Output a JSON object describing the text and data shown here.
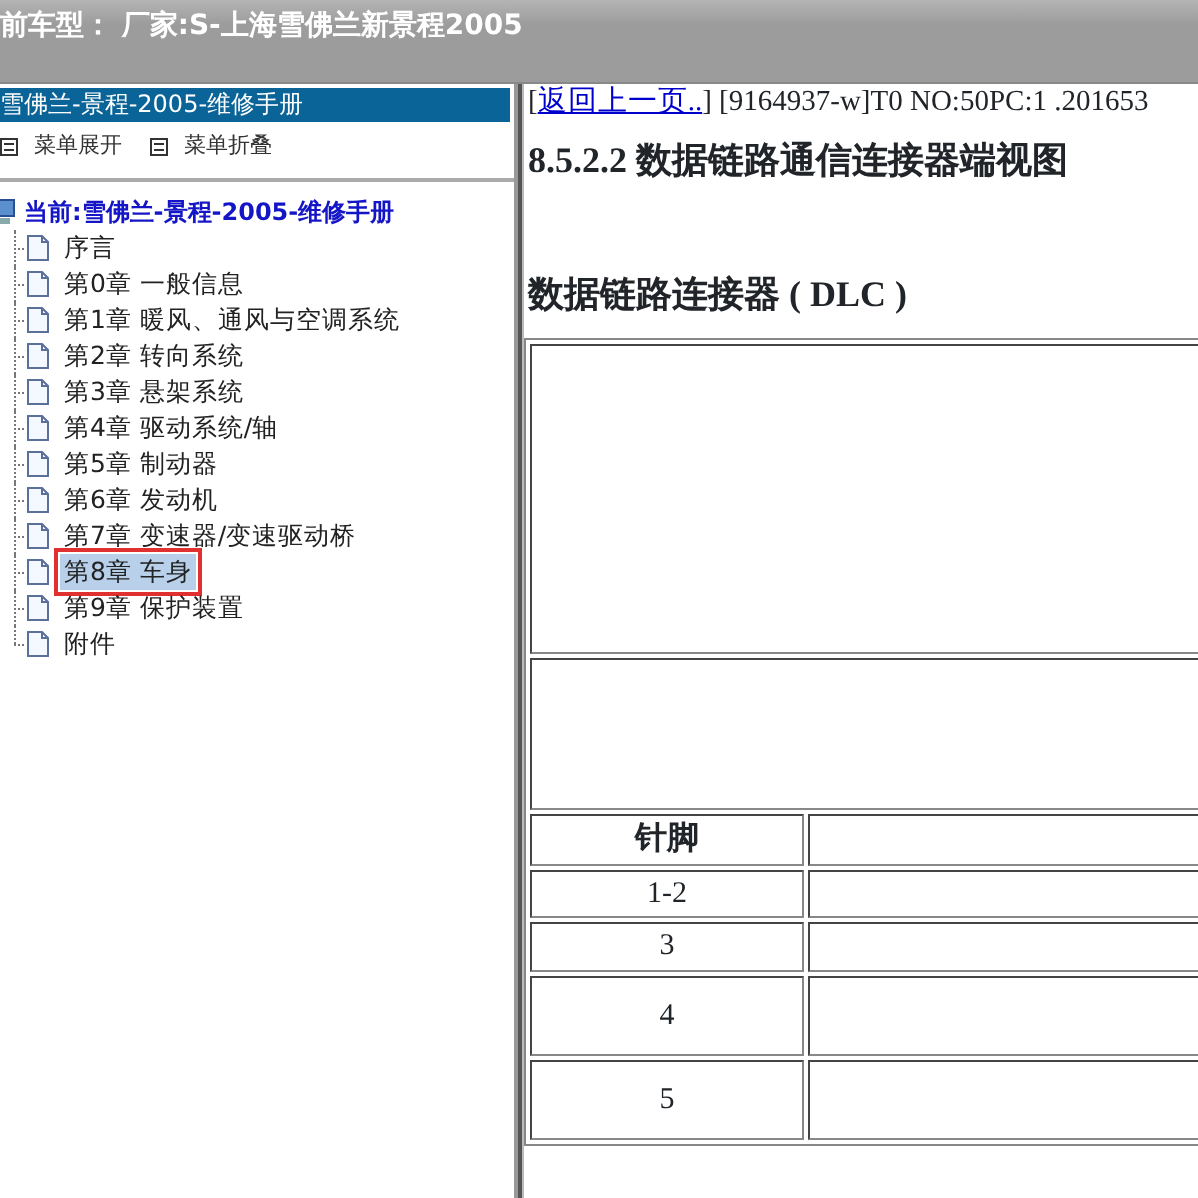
{
  "title_bar": {
    "text": "前车型： 厂家:S-上海雪佛兰新景程2005"
  },
  "sidebar": {
    "header": "雪佛兰-景程-2005-维修手册",
    "menu_actions": [
      {
        "label": "菜单展开"
      },
      {
        "label": "菜单折叠"
      }
    ],
    "tree": {
      "label": "当前:雪佛兰-景程-2005-维修手册",
      "children": [
        {
          "label": "序言",
          "selected": false
        },
        {
          "label": "第0章 一般信息",
          "selected": false
        },
        {
          "label": "第1章 暖风、通风与空调系统",
          "selected": false
        },
        {
          "label": "第2章 转向系统",
          "selected": false
        },
        {
          "label": "第3章 悬架系统",
          "selected": false
        },
        {
          "label": "第4章 驱动系统/轴",
          "selected": false
        },
        {
          "label": "第5章 制动器",
          "selected": false
        },
        {
          "label": "第6章 发动机",
          "selected": false
        },
        {
          "label": "第7章 变速器/变速驱动桥",
          "selected": false
        },
        {
          "label": "第8章 车身",
          "selected": true
        },
        {
          "label": "第9章 保护装置",
          "selected": false
        },
        {
          "label": "附件",
          "selected": false
        }
      ]
    }
  },
  "content": {
    "open_bracket": "[",
    "back_link": "返回上一页..",
    "doc_info": "] [9164937-w]T0 NO:50PC:1 .201653",
    "heading": "8.5.2.2 数据链路通信连接器端视图",
    "subheading": "数据链路连接器 ( DLC )",
    "table": {
      "columns": [
        "针脚"
      ],
      "rows": [
        {
          "pin": "1-2",
          "kind": "short"
        },
        {
          "pin": "3",
          "kind": "short"
        },
        {
          "pin": "4",
          "kind": "tall"
        },
        {
          "pin": "5",
          "kind": "tall"
        }
      ]
    }
  }
}
